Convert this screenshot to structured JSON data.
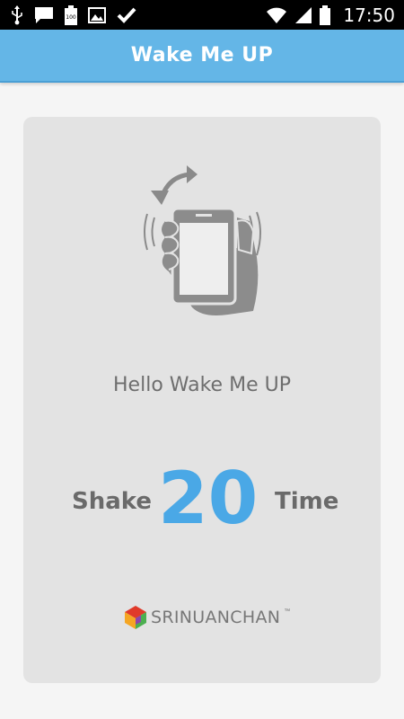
{
  "status_bar": {
    "time": "17:50",
    "battery_badge": "100",
    "left_icons": [
      "usb-icon",
      "message-icon",
      "battery-full-icon",
      "image-icon",
      "checkmark-icon"
    ],
    "right_icons": [
      "wifi-icon",
      "signal-icon",
      "battery-icon"
    ]
  },
  "app_bar": {
    "title": "Wake Me UP",
    "color": "#64b6e7"
  },
  "main": {
    "illustration": "hand-shaking-phone-icon",
    "greeting": "Hello Wake Me UP",
    "shake_label": "Shake",
    "shake_count": "20",
    "time_label": "Time",
    "accent_color": "#4aa8e6"
  },
  "brand": {
    "name": "SRINUANCHAN",
    "trademark": "™"
  }
}
